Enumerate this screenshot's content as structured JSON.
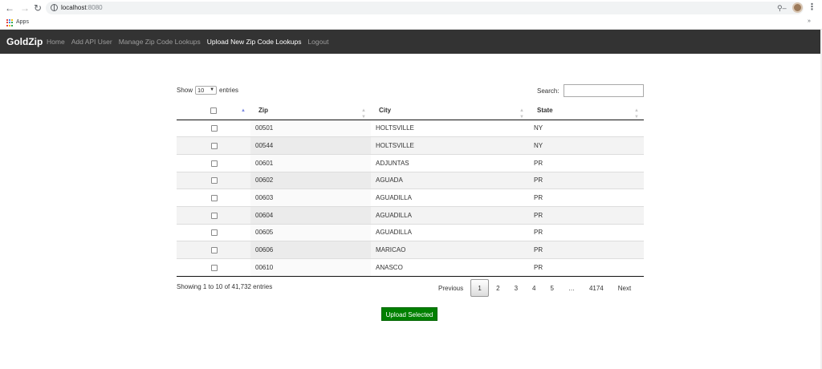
{
  "browser": {
    "url_host": "localhost",
    "url_port": ":8080",
    "bookmarks_apps": "Apps",
    "bookmarks_more": "»"
  },
  "navbar": {
    "brand": "GoldZip",
    "links": [
      {
        "label": "Home",
        "active": false
      },
      {
        "label": "Add API User",
        "active": false
      },
      {
        "label": "Manage Zip Code Lookups",
        "active": false
      },
      {
        "label": "Upload New Zip Code Lookups",
        "active": true
      },
      {
        "label": "Logout",
        "active": false
      }
    ],
    "background_color": "#333333"
  },
  "table_controls": {
    "show_label": "Show",
    "page_length": "10",
    "entries_label": "entries",
    "search_label": "Search:",
    "search_value": ""
  },
  "table": {
    "columns": [
      "",
      "Zip",
      "City",
      "State"
    ],
    "sorted_column": "Zip",
    "sort_direction": "ascending",
    "rows": [
      {
        "zip": "00501",
        "city": "HOLTSVILLE",
        "state": "NY",
        "checked": false
      },
      {
        "zip": "00544",
        "city": "HOLTSVILLE",
        "state": "NY",
        "checked": false
      },
      {
        "zip": "00601",
        "city": "ADJUNTAS",
        "state": "PR",
        "checked": false
      },
      {
        "zip": "00602",
        "city": "AGUADA",
        "state": "PR",
        "checked": false
      },
      {
        "zip": "00603",
        "city": "AGUADILLA",
        "state": "PR",
        "checked": false
      },
      {
        "zip": "00604",
        "city": "AGUADILLA",
        "state": "PR",
        "checked": false
      },
      {
        "zip": "00605",
        "city": "AGUADILLA",
        "state": "PR",
        "checked": false
      },
      {
        "zip": "00606",
        "city": "MARICAO",
        "state": "PR",
        "checked": false
      },
      {
        "zip": "00610",
        "city": "ANASCO",
        "state": "PR",
        "checked": false
      }
    ]
  },
  "footer": {
    "info": "Showing 1 to 10 of 41,732 entries",
    "pagination": {
      "previous": "Previous",
      "pages": [
        "1",
        "2",
        "3",
        "4",
        "5"
      ],
      "current": "1",
      "ellipsis": "…",
      "last": "4174",
      "next": "Next"
    }
  },
  "actions": {
    "upload_label": "Upload Selected",
    "upload_color": "#008000"
  }
}
